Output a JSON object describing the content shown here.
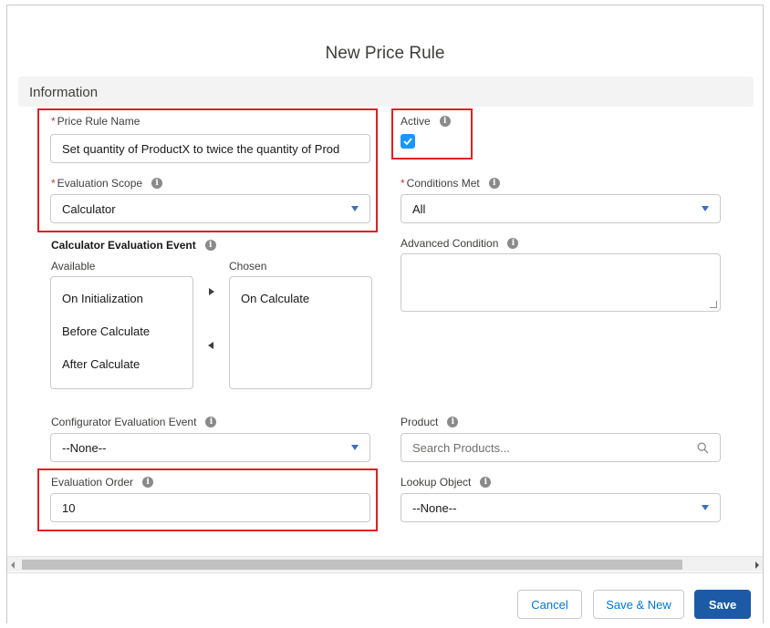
{
  "modal": {
    "title": "New Price Rule"
  },
  "section": {
    "title": "Information"
  },
  "fields": {
    "price_rule_name": {
      "label": "Price Rule Name",
      "required_mark": "*",
      "value": "Set quantity of ProductX to twice the quantity of Prod"
    },
    "active": {
      "label": "Active",
      "checked": true
    },
    "evaluation_scope": {
      "label": "Evaluation Scope",
      "required_mark": "*",
      "value": "Calculator"
    },
    "conditions_met": {
      "label": "Conditions Met",
      "required_mark": "*",
      "value": "All"
    },
    "calculator_event": {
      "label": "Calculator Evaluation Event",
      "available_label": "Available",
      "chosen_label": "Chosen",
      "available": [
        "On Initialization",
        "Before Calculate",
        "After Calculate"
      ],
      "chosen": [
        "On Calculate"
      ]
    },
    "advanced_condition": {
      "label": "Advanced Condition",
      "value": ""
    },
    "configurator_event": {
      "label": "Configurator Evaluation Event",
      "value": "--None--"
    },
    "product": {
      "label": "Product",
      "placeholder": "Search Products..."
    },
    "evaluation_order": {
      "label": "Evaluation Order",
      "value": "10"
    },
    "lookup_object": {
      "label": "Lookup Object",
      "value": "--None--"
    }
  },
  "footer": {
    "cancel_label": "Cancel",
    "save_new_label": "Save & New",
    "save_label": "Save"
  },
  "icons": {
    "info": "info-icon",
    "dropdown": "chevron-down-icon",
    "search": "search-icon",
    "check": "check-icon",
    "move_right": "arrow-right-icon",
    "move_left": "arrow-left-icon"
  },
  "colors": {
    "brand": "#1c5aa6",
    "link": "#0176d3",
    "checkbox": "#1b96ff",
    "required": "#c23934",
    "highlight": "#e02020"
  }
}
